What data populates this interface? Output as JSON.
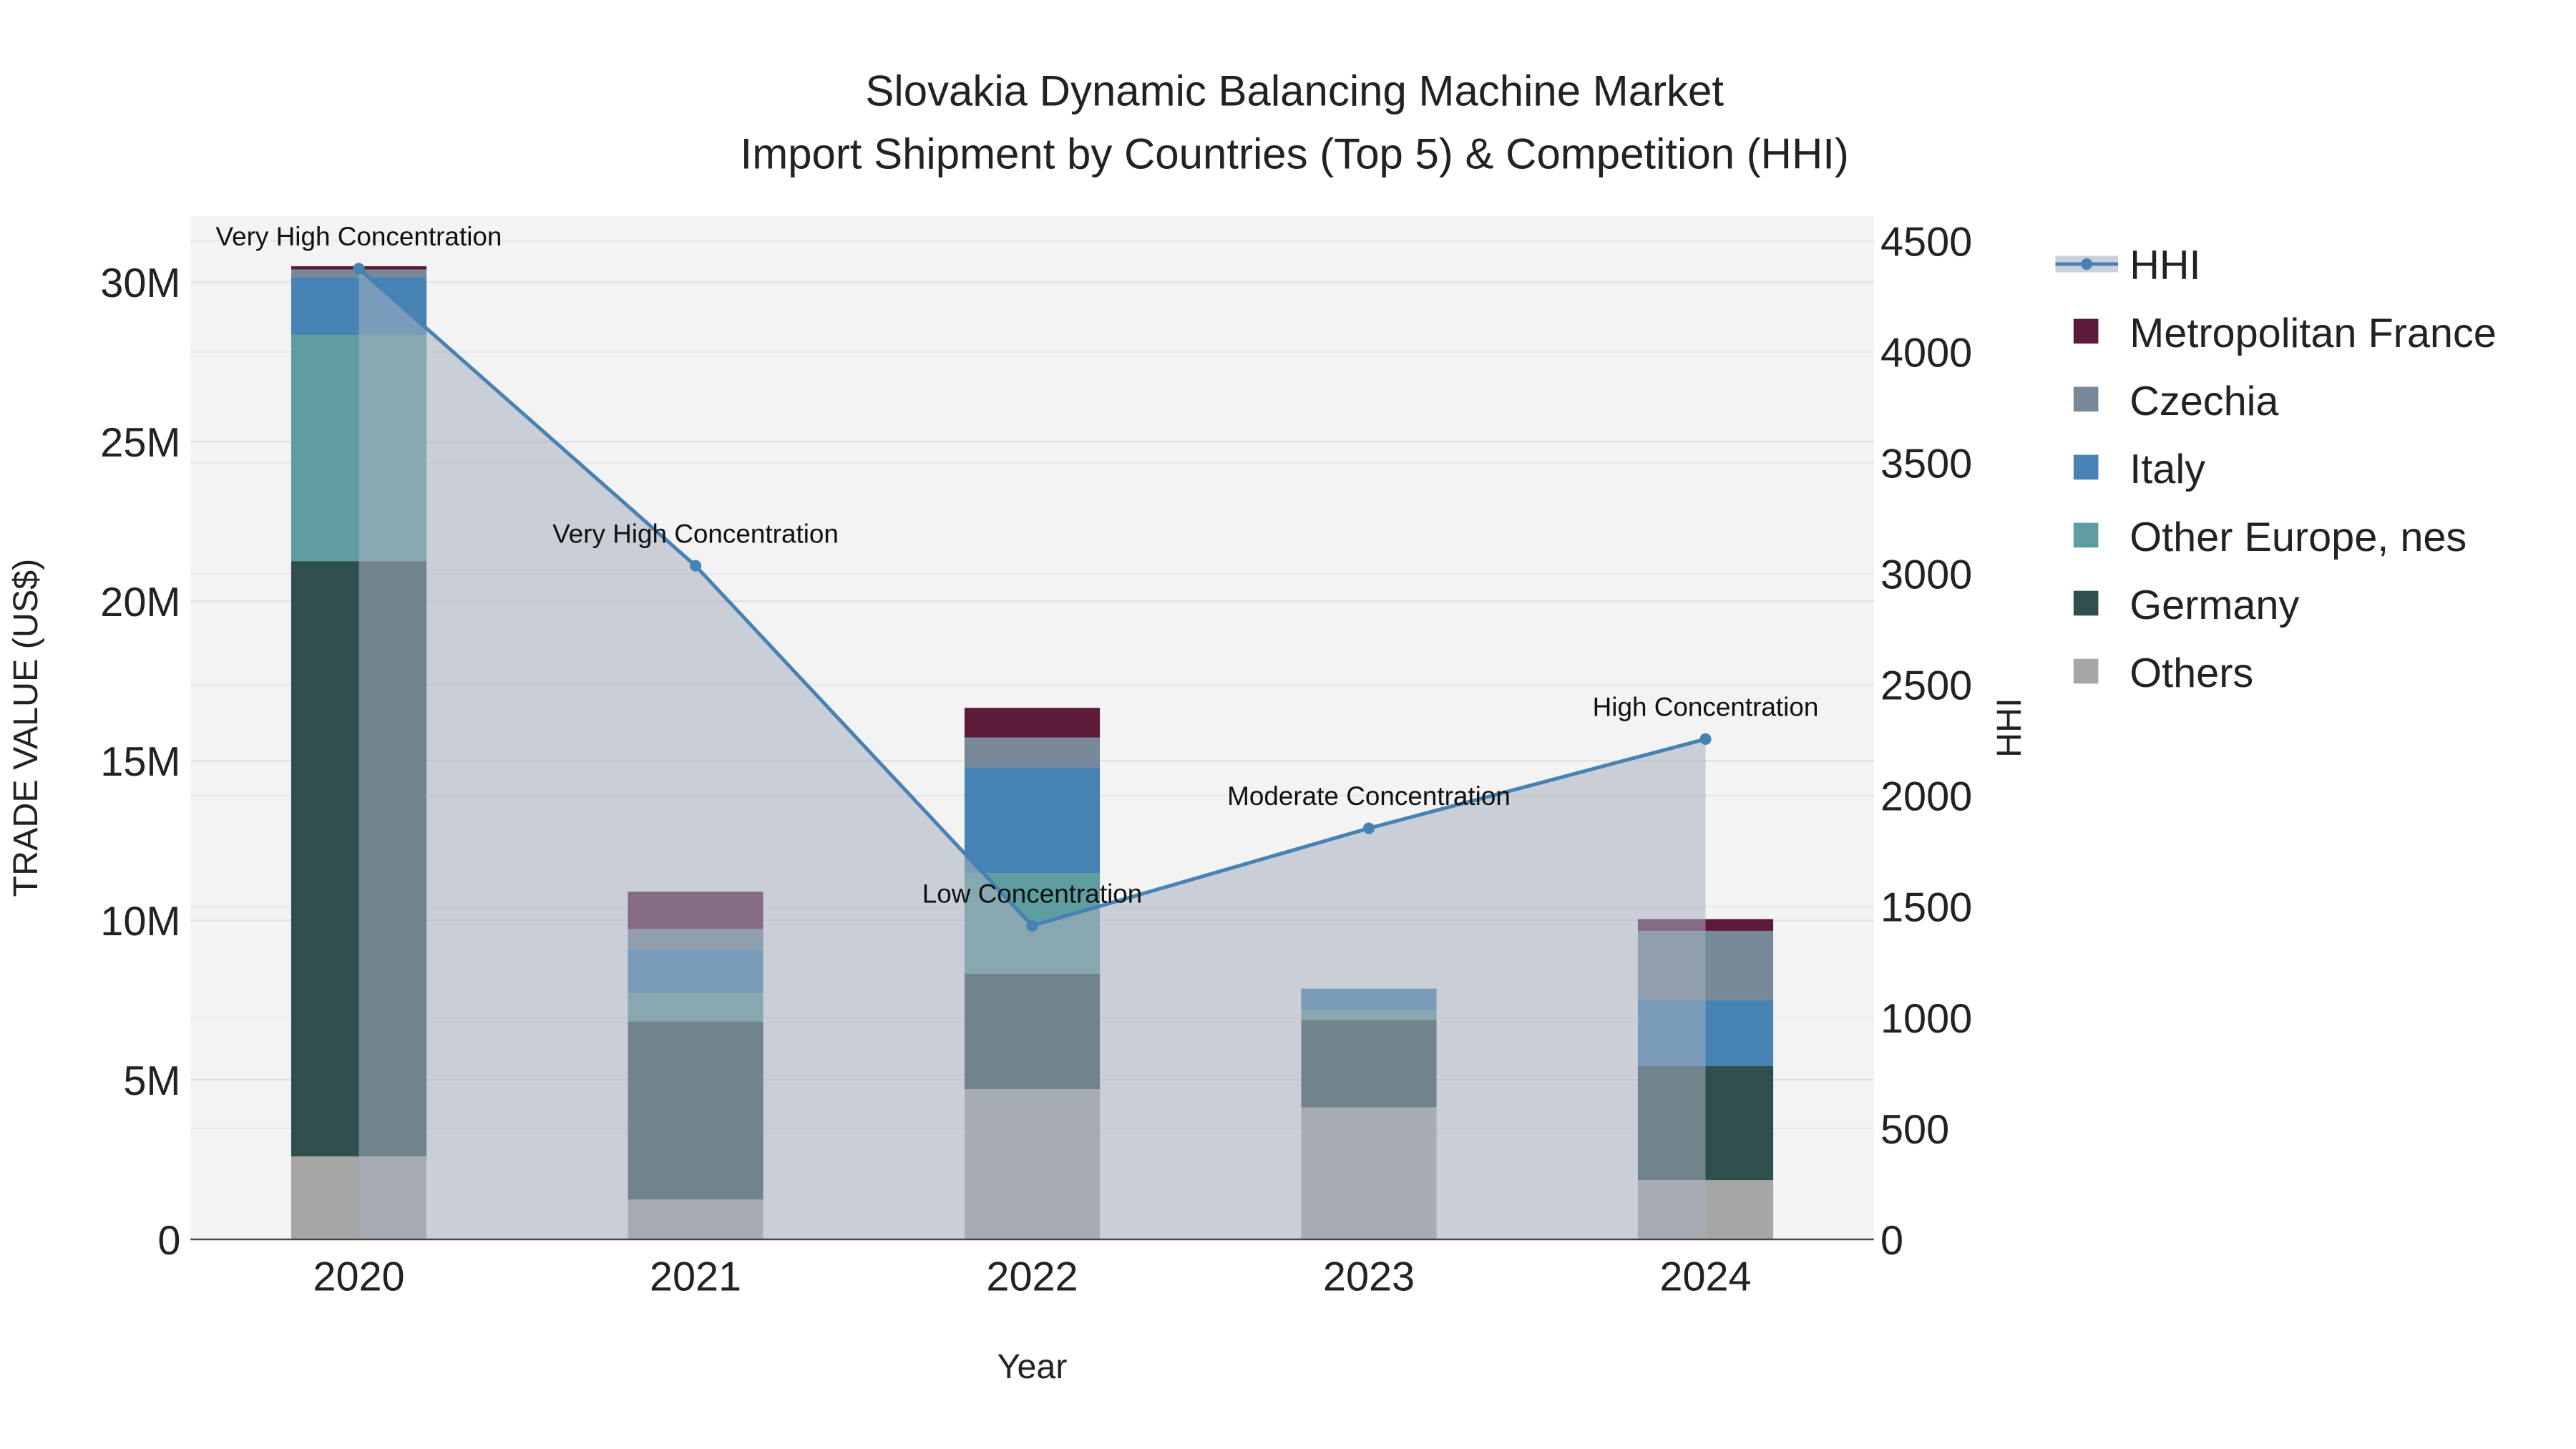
{
  "chart_data": {
    "type": "bar",
    "title_line1": "Slovakia Dynamic Balancing Machine Market",
    "title_line2": "Import Shipment by Countries (Top 5) & Competition (HHI)",
    "xlabel": "Year",
    "ylabel": "TRADE VALUE (US$)",
    "y2label": "HHI",
    "categories": [
      "2020",
      "2021",
      "2022",
      "2023",
      "2024"
    ],
    "ylim": [
      0,
      32000000
    ],
    "y2lim": [
      0,
      4620
    ],
    "yticks": [
      0,
      5000000,
      10000000,
      15000000,
      20000000,
      25000000,
      30000000
    ],
    "yticklabels": [
      "0",
      "5M",
      "10M",
      "15M",
      "20M",
      "25M",
      "30M"
    ],
    "y2ticks": [
      0,
      500,
      1000,
      1500,
      2000,
      2500,
      3000,
      3500,
      4000,
      4500
    ],
    "y2ticklabels": [
      "0",
      "500",
      "1000",
      "1500",
      "2000",
      "2500",
      "3000",
      "3500",
      "4000",
      "4500"
    ],
    "stacked": true,
    "series": [
      {
        "name": "Others",
        "color": "#a6a6a6",
        "values": [
          2600000,
          1250000,
          4710000,
          4140000,
          1860000
        ]
      },
      {
        "name": "Germany",
        "color": "#2f4f4f",
        "values": [
          18660000,
          5580000,
          3620000,
          2740000,
          3570000
        ]
      },
      {
        "name": "Other Europe, nes",
        "color": "#5f9ea0",
        "values": [
          7090000,
          880000,
          3150000,
          310000,
          0
        ]
      },
      {
        "name": "Italy",
        "color": "#4682b4",
        "values": [
          1810000,
          1390000,
          3320000,
          670000,
          2070000
        ]
      },
      {
        "name": "Czechia",
        "color": "#778899",
        "values": [
          240000,
          630000,
          930000,
          0,
          2170000
        ]
      },
      {
        "name": "Metropolitan France",
        "color": "#5c1a3a",
        "values": [
          100000,
          1170000,
          930000,
          0,
          370000
        ]
      }
    ],
    "hhi": {
      "name": "HHI",
      "color": "#4682b4",
      "values": [
        4375,
        3036,
        1414,
        1853,
        2255
      ],
      "annotations": [
        "Very High Concentration",
        "Very High Concentration",
        "Low Concentration",
        "Moderate Concentration",
        "High Concentration"
      ]
    },
    "legend_order": [
      "HHI",
      "Metropolitan France",
      "Czechia",
      "Italy",
      "Other Europe, nes",
      "Germany",
      "Others"
    ],
    "legend_placement": "right",
    "grid": true
  }
}
